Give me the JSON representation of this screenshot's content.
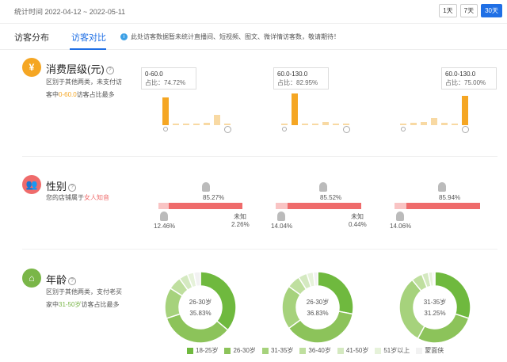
{
  "header": {
    "range_label": "统计时间 2022-04-12 ~ 2022-05-11",
    "range_buttons": [
      {
        "label": "1天",
        "active": false
      },
      {
        "label": "7天",
        "active": false
      },
      {
        "label": "30天",
        "active": true
      }
    ]
  },
  "tabs": [
    {
      "label": "访客分布",
      "active": false
    },
    {
      "label": "访客对比",
      "active": true
    }
  ],
  "notice": "此处访客数据暂未统计直播间、短视频、图文、微详情访客数，敬请期待！",
  "consumption": {
    "title": "消费层级(元)",
    "desc_line1": "区别于其他两类，未支付访",
    "desc_line2_pre": "客中",
    "desc_line2_hl": "0-60.0",
    "desc_line2_post": "访客占比最多",
    "accent": "#f5a623",
    "groups": [
      {
        "tip_range": "0-60.0",
        "tip_share": "占比：74.72%",
        "bars": [
          0.78,
          0.03,
          0.04,
          0.03,
          0.06,
          0.28,
          0.03
        ]
      },
      {
        "tip_range": "60.0-130.0",
        "tip_share": "占比：82.95%",
        "bars": [
          0.05,
          0.88,
          0.05,
          0.04,
          0.1,
          0.04,
          0.03
        ]
      },
      {
        "tip_range": "60.0-130.0",
        "tip_share": "占比：75.00%",
        "bars": [
          0.03,
          0.06,
          0.08,
          0.2,
          0.06,
          0.05,
          0.82
        ]
      }
    ]
  },
  "gender": {
    "title": "性别",
    "desc_pre": "您的店铺属于",
    "desc_hl": "女人知音",
    "accent": "#ef6b6b",
    "groups": [
      {
        "female": "85.27%",
        "male": "12.46%",
        "unknown_label": "未知",
        "unknown": "2.26%",
        "female_v": 85.27,
        "male_v": 12.46
      },
      {
        "female": "85.52%",
        "male": "14.04%",
        "unknown_label": "未知",
        "unknown": "0.44%",
        "female_v": 85.52,
        "male_v": 14.04
      },
      {
        "female": "85.94%",
        "male": "14.06%",
        "unknown_label": "",
        "unknown": "",
        "female_v": 85.94,
        "male_v": 14.06
      }
    ]
  },
  "age": {
    "title": "年龄",
    "desc_line1": "区别于其他两类，支付老买",
    "desc_line2_pre": "家中",
    "desc_line2_hl": "31-50岁",
    "desc_line2_post": "访客占比最多",
    "accent": "#7ab648",
    "donuts": [
      {
        "label": "26-30岁",
        "value": "35.83%",
        "slices": [
          0.36,
          0.34,
          0.14,
          0.06,
          0.04,
          0.03,
          0.03
        ]
      },
      {
        "label": "26-30岁",
        "value": "36.83%",
        "slices": [
          0.28,
          0.37,
          0.2,
          0.06,
          0.04,
          0.03,
          0.02
        ]
      },
      {
        "label": "31-35岁",
        "value": "31.25%",
        "slices": [
          0.3,
          0.28,
          0.31,
          0.05,
          0.03,
          0.02,
          0.01
        ]
      }
    ],
    "legend": [
      "18-25岁",
      "26-30岁",
      "31-35岁",
      "36-40岁",
      "41-50岁",
      "51岁以上",
      "蒙面侠"
    ],
    "legend_colors": [
      "#6fb93e",
      "#8cc35a",
      "#a6d27c",
      "#bfdf9f",
      "#d4e9c0",
      "#e6f2da",
      "#f2f2f2"
    ]
  }
}
